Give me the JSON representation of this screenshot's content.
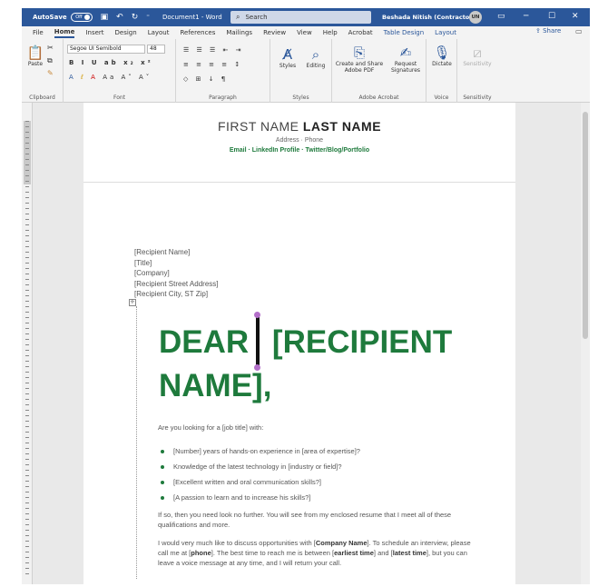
{
  "titlebar": {
    "autosave_label": "AutoSave",
    "autosave_state": "Off",
    "doc_name": "Document1 - Word",
    "search_placeholder": "Search",
    "user_name": "Beshada Nitish (Contractor)",
    "user_initials": "UN"
  },
  "menu": {
    "tabs": [
      "File",
      "Home",
      "Insert",
      "Design",
      "Layout",
      "References",
      "Mailings",
      "Review",
      "View",
      "Help",
      "Acrobat",
      "Table Design",
      "Layout"
    ],
    "active": "Home",
    "share_label": "Share"
  },
  "ribbon": {
    "clipboard": {
      "paste": "Paste",
      "label": "Clipboard"
    },
    "font": {
      "name": "Segoe UI Semibold",
      "size": "48",
      "label": "Font"
    },
    "paragraph": {
      "label": "Paragraph"
    },
    "styles": {
      "styles": "Styles",
      "editing": "Editing",
      "label": "Styles"
    },
    "acrobat": {
      "create_share_1": "Create and Share",
      "create_share_2": "Adobe PDF",
      "request_1": "Request",
      "request_2": "Signatures",
      "label": "Adobe Acrobat"
    },
    "voice": {
      "dictate": "Dictate",
      "label": "Voice"
    },
    "sensitivity": {
      "btn": "Sensitivity",
      "label": "Sensitivity"
    }
  },
  "document": {
    "first_name": "FIRST NAME",
    "last_name": "LAST NAME",
    "contact": "Address · Phone",
    "links": "Email · LinkedIn Profile · Twitter/Blog/Portfolio",
    "recipient": [
      "[Recipient Name]",
      "[Title]",
      "[Company]",
      "[Recipient Street Address]",
      "[Recipient City, ST Zip]"
    ],
    "salutation_1": "DEAR",
    "salutation_2": "[RECIPIENT",
    "salutation_3": "NAME],",
    "intro": "Are you looking for a [job title] with:",
    "bullets": [
      "[Number] years of hands-on experience in [area of expertise]?",
      "Knowledge of the latest technology in [industry or field]?",
      "[Excellent written and oral communication skills?]",
      "[A passion to learn and to increase his skills?]"
    ],
    "para1": "If so, then you need look no further. You will see from my enclosed resume that I meet all of these qualifications and more.",
    "para2_a": "I would very much like to discuss opportunities with [",
    "company": "Company Name",
    "para2_b": "]. To schedule an interview, please call me at [",
    "phone": "phone",
    "para2_c": "]. The best time to reach me is between [",
    "earliest": "earliest time",
    "para2_d": "] and [",
    "latest": "latest time",
    "para2_e": "], but you can leave a voice message at any time, and I will return your call."
  }
}
